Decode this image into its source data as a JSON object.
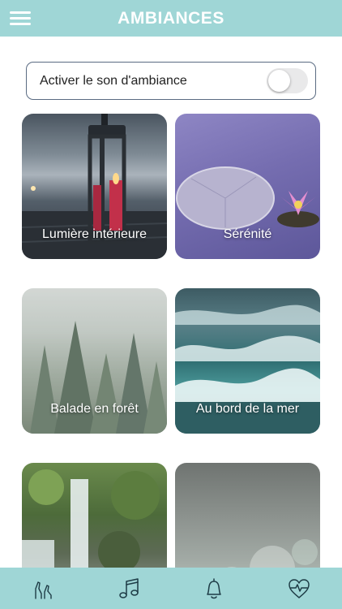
{
  "header": {
    "title": "AMBIANCES",
    "menu_icon": "hamburger-menu-icon"
  },
  "ambient_toggle": {
    "label": "Activer le son d'ambiance",
    "enabled": false
  },
  "cards": [
    {
      "label": "Lumière intérieure",
      "image": "lantern-candle-lake"
    },
    {
      "label": "Sérénité",
      "image": "lotus-lily-pad"
    },
    {
      "label": "Balade en forêt",
      "image": "misty-forest"
    },
    {
      "label": "Au bord de la mer",
      "image": "ocean-waves"
    },
    {
      "label": "",
      "image": "waterfall"
    },
    {
      "label": "",
      "image": "soft-bokeh"
    }
  ],
  "tabbar": {
    "tabs": [
      {
        "icon": "hands-icon"
      },
      {
        "icon": "music-note-icon"
      },
      {
        "icon": "bell-icon"
      },
      {
        "icon": "heart-pulse-icon"
      }
    ]
  },
  "colors": {
    "accent": "#9fd6d6",
    "toggle_border": "#5a6b82",
    "icon_dark": "#1e3c46"
  }
}
